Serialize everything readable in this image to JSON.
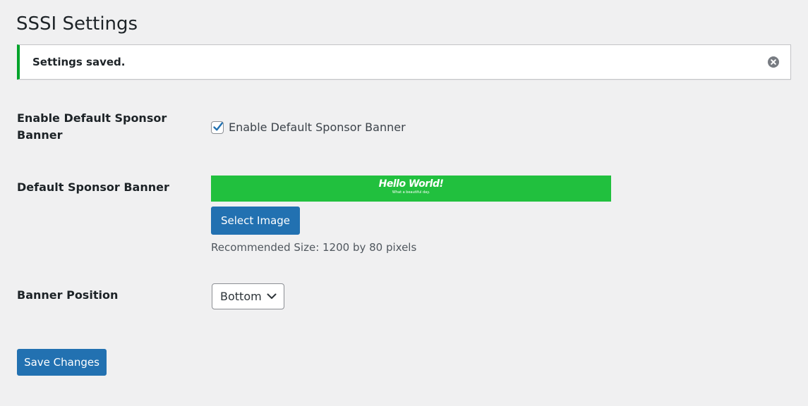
{
  "page": {
    "title": "SSSI Settings"
  },
  "notice": {
    "message": "Settings saved.",
    "type": "success",
    "accent_color": "#00a32a",
    "dismiss_icon": "dismiss-icon"
  },
  "settings": {
    "enable_banner": {
      "label": "Enable Default Sponsor Banner",
      "checkbox_label": "Enable Default Sponsor Banner",
      "checked": true
    },
    "default_banner": {
      "label": "Default Sponsor Banner",
      "preview": {
        "title": "Hello World!",
        "subtitle": "What a beautiful day.",
        "background_color": "#21c03e"
      },
      "select_button_label": "Select Image",
      "help_text": "Recommended Size: 1200 by 80 pixels"
    },
    "banner_position": {
      "label": "Banner Position",
      "selected_value": "Bottom"
    }
  },
  "actions": {
    "save_label": "Save Changes",
    "button_color": "#2271b1"
  }
}
